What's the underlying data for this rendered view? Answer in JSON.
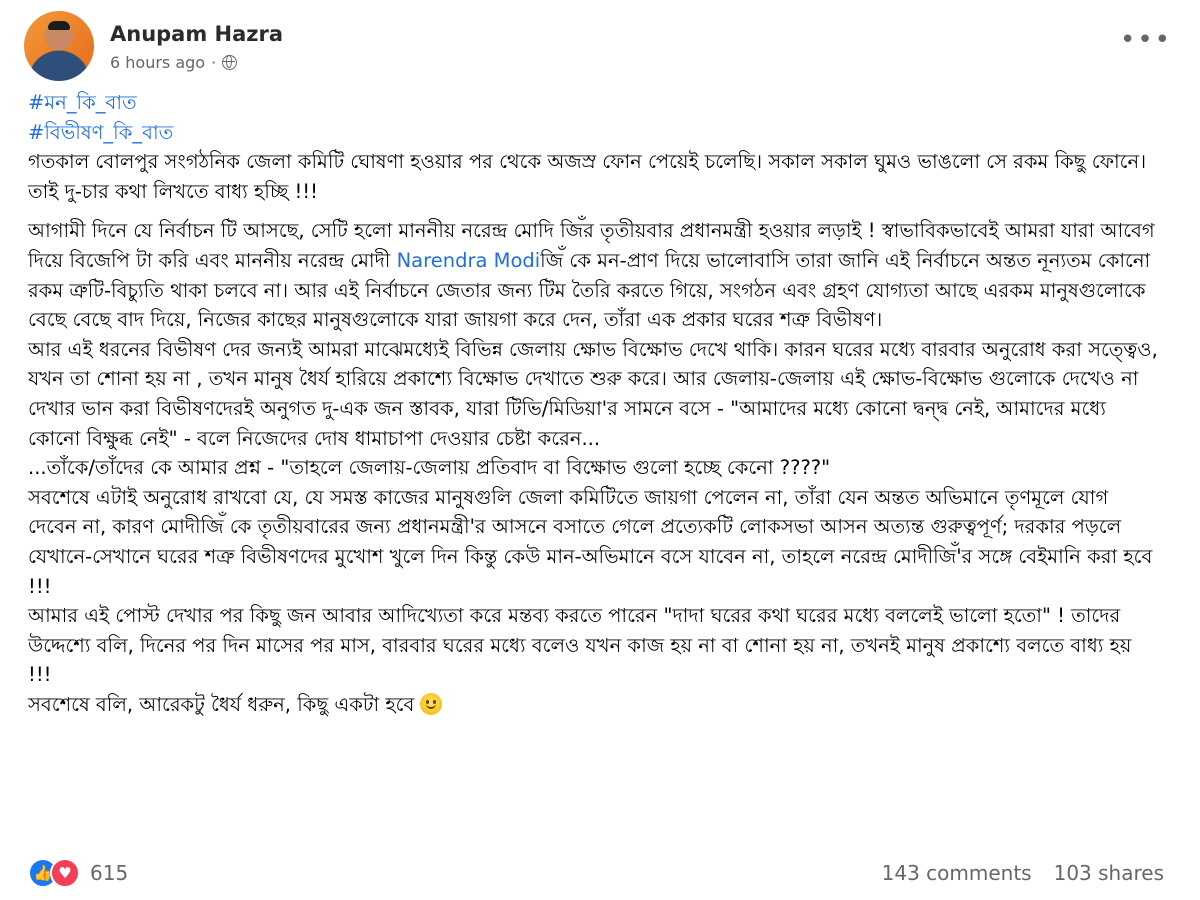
{
  "post": {
    "author": "Anupam Hazra",
    "timestamp": "6 hours ago",
    "separator": "·",
    "privacy_icon": "globe-icon",
    "more_label": "•••",
    "hashtags": [
      "#মন_কি_বাত",
      "#বিভীষণ_কি_বাত"
    ],
    "paragraphs": {
      "p1": "গতকাল বোলপুর সংগঠনিক জেলা কমিটি ঘোষণা হওয়ার পর থেকে অজস্র ফোন পেয়েই চলেছি। সকাল সকাল ঘুমও ভাঙলো সে রকম কিছু ফোনে। তাই দু-চার কথা লিখতে বাধ্য হচ্ছি !!!",
      "p2_before": "আগামী দিনে যে নির্বাচন টি আসছে, সেটি হলো মাননীয় নরেন্দ্র মোদি জিঁর তৃতীয়বার প্রধানমন্ত্রী হওয়ার লড়াই ! স্বাভাবিকভাবেই আমরা যারা আবেগ দিয়ে বিজেপি টা করি এবং মাননীয় নরেন্দ্র মোদী ",
      "p2_mention": "Narendra Modi",
      "p2_after": "জিঁ কে মন-প্রাণ দিয়ে ভালোবাসি  তারা জানি এই নির্বাচনে অন্তত নূন্যতম কোনো রকম ত্রুটি-বিচ্যুতি থাকা চলবে না। আর এই নির্বাচনে জেতার জন্য টিম তৈরি করতে গিয়ে,  সংগঠন এবং গ্রহণ যোগ্যতা আছে এরকম মানুষগুলোকে বেছে বেছে বাদ দিয়ে, নিজের কাছের মানুষগুলোকে যারা জায়গা করে দেন, তাঁরা এক প্রকার ঘরের শত্রু বিভীষণ।",
      "p3": "আর এই ধরনের বিভীষণ দের জন্যই আমরা মাঝেমধ্যেই বিভিন্ন জেলায় ক্ষোভ বিক্ষোভ দেখে থাকি। কারন ঘরের মধ্যে বারবার অনুরোধ করা সত্ত্বেও, যখন তা শোনা হয় না , তখন মানুষ ধৈর্য হারিয়ে প্রকাশ্যে বিক্ষোভ দেখাতে শুরু করে। আর জেলায়-জেলায় এই ক্ষোভ-বিক্ষোভ গুলোকে দেখেও না দেখার ভান করা বিভীষণদেরই অনুগত দু-এক জন স্তাবক, যারা টিভি/মিডিয়া'র সামনে বসে - \"আমাদের মধ্যে কোনো দ্বন্দ্ব নেই, আমাদের মধ্যে কোনো বিক্ষুব্ধ নেই\" - বলে নিজেদের দোষ ধামাচাপা দেওয়ার চেষ্টা করেন...",
      "p4": "...তাঁকে/তাঁদের কে আমার প্রশ্ন - \"তাহলে জেলায়-জেলায় প্রতিবাদ বা বিক্ষোভ গুলো হচ্ছে কেনো ????\"",
      "p5": "সবশেষে এটাই অনুরোধ রাখবো যে, যে সমস্ত কাজের মানুষগুলি জেলা কমিটিতে জায়গা পেলেন না, তাঁরা যেন অন্তত অভিমানে তৃণমূলে যোগ দেবেন না, কারণ মোদীজিঁ কে তৃতীয়বারের জন্য প্রধানমন্ত্রী'র আসনে বসাতে গেলে প্রত্যেকটি লোকসভা আসন অত্যন্ত গুরুত্বপূর্ণ; দরকার পড়লে যেখানে-সেখানে ঘরের শত্রু বিভীষণদের মুখোশ খুলে দিন কিন্তু কেউ মান-অভিমানে বসে যাবেন না, তাহলে নরেন্দ্র মোদীজিঁ'র সঙ্গে বেইমানি করা হবে !!!",
      "p6": "আমার এই পোস্ট দেখার পর কিছু জন আবার আদিখ্যেতা করে মন্তব্য করতে পারেন \"দাদা ঘরের কথা ঘরের মধ্যে বললেই ভালো হতো\" ! তাদের উদ্দেশ্যে বলি, দিনের পর দিন মাসের পর মাস, বারবার ঘরের মধ্যে বলেও যখন কাজ হয় না বা শোনা হয় না, তখনই মানুষ প্রকাশ্যে বলতে বাধ্য হয় !!!",
      "p7": "সবশেষে বলি, আরেকটু ধৈর্য ধরুন, কিছু একটা হবে"
    },
    "closing_emoji": "smile-emoji-icon",
    "reactions": {
      "icons": [
        "like-icon",
        "love-icon"
      ],
      "count": "615"
    },
    "comments": "143 comments",
    "shares": "103 shares"
  },
  "colors": {
    "link": "#216fdb",
    "meta_text": "#65676b",
    "like": "#1877f2",
    "love": "#f33e58"
  }
}
